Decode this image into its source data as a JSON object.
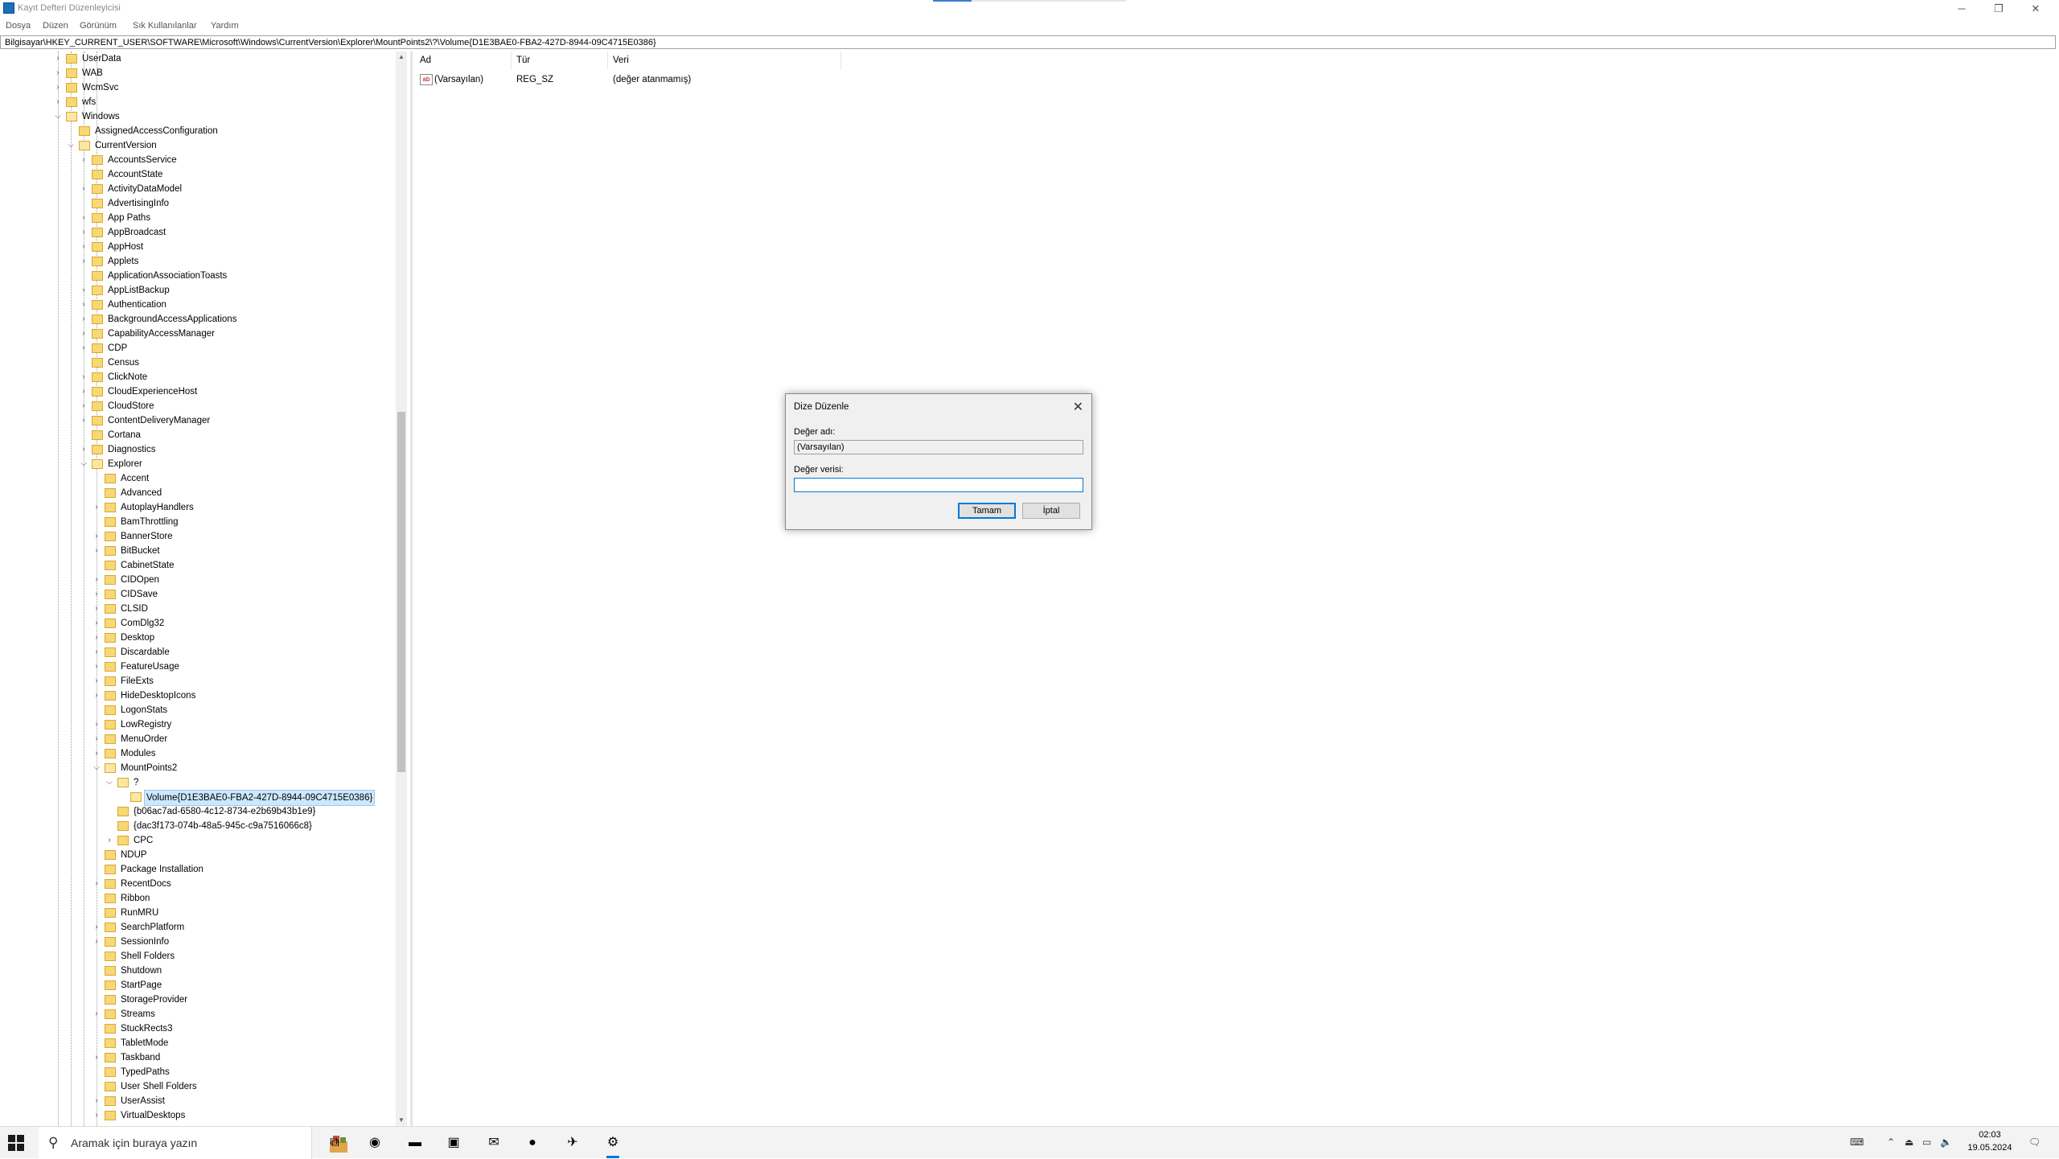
{
  "window": {
    "title": "Kayıt Defteri Düzenleyicisi",
    "controls": {
      "minimize": "─",
      "restore": "❐",
      "close": "✕"
    }
  },
  "menu": [
    "Dosya",
    "Düzen",
    "Görünüm",
    "Sık Kullanılanlar",
    "Yardım"
  ],
  "address": "Bilgisayar\\HKEY_CURRENT_USER\\SOFTWARE\\Microsoft\\Windows\\CurrentVersion\\Explorer\\MountPoints2\\?\\Volume{D1E3BAE0-FBA2-427D-8944-09C4715E0386}",
  "tree": [
    {
      "label": "UserData",
      "depth": 0,
      "exp": "right"
    },
    {
      "label": "WAB",
      "depth": 0,
      "exp": "right"
    },
    {
      "label": "WcmSvc",
      "depth": 0,
      "exp": "right"
    },
    {
      "label": "wfs",
      "depth": 0,
      "exp": "right"
    },
    {
      "label": "Windows",
      "depth": 0,
      "exp": "down"
    },
    {
      "label": "AssignedAccessConfiguration",
      "depth": 1,
      "exp": ""
    },
    {
      "label": "CurrentVersion",
      "depth": 1,
      "exp": "down"
    },
    {
      "label": "AccountsService",
      "depth": 2,
      "exp": "right"
    },
    {
      "label": "AccountState",
      "depth": 2,
      "exp": ""
    },
    {
      "label": "ActivityDataModel",
      "depth": 2,
      "exp": "right"
    },
    {
      "label": "AdvertisingInfo",
      "depth": 2,
      "exp": ""
    },
    {
      "label": "App Paths",
      "depth": 2,
      "exp": "right"
    },
    {
      "label": "AppBroadcast",
      "depth": 2,
      "exp": "right"
    },
    {
      "label": "AppHost",
      "depth": 2,
      "exp": "right"
    },
    {
      "label": "Applets",
      "depth": 2,
      "exp": "right"
    },
    {
      "label": "ApplicationAssociationToasts",
      "depth": 2,
      "exp": ""
    },
    {
      "label": "AppListBackup",
      "depth": 2,
      "exp": "right"
    },
    {
      "label": "Authentication",
      "depth": 2,
      "exp": "right"
    },
    {
      "label": "BackgroundAccessApplications",
      "depth": 2,
      "exp": "right"
    },
    {
      "label": "CapabilityAccessManager",
      "depth": 2,
      "exp": "right"
    },
    {
      "label": "CDP",
      "depth": 2,
      "exp": "right"
    },
    {
      "label": "Census",
      "depth": 2,
      "exp": ""
    },
    {
      "label": "ClickNote",
      "depth": 2,
      "exp": "right"
    },
    {
      "label": "CloudExperienceHost",
      "depth": 2,
      "exp": "right"
    },
    {
      "label": "CloudStore",
      "depth": 2,
      "exp": "right"
    },
    {
      "label": "ContentDeliveryManager",
      "depth": 2,
      "exp": "right"
    },
    {
      "label": "Cortana",
      "depth": 2,
      "exp": ""
    },
    {
      "label": "Diagnostics",
      "depth": 2,
      "exp": "right"
    },
    {
      "label": "Explorer",
      "depth": 2,
      "exp": "down"
    },
    {
      "label": "Accent",
      "depth": 3,
      "exp": ""
    },
    {
      "label": "Advanced",
      "depth": 3,
      "exp": ""
    },
    {
      "label": "AutoplayHandlers",
      "depth": 3,
      "exp": "right"
    },
    {
      "label": "BamThrottling",
      "depth": 3,
      "exp": ""
    },
    {
      "label": "BannerStore",
      "depth": 3,
      "exp": "right"
    },
    {
      "label": "BitBucket",
      "depth": 3,
      "exp": "right"
    },
    {
      "label": "CabinetState",
      "depth": 3,
      "exp": ""
    },
    {
      "label": "CIDOpen",
      "depth": 3,
      "exp": "right"
    },
    {
      "label": "CIDSave",
      "depth": 3,
      "exp": "right"
    },
    {
      "label": "CLSID",
      "depth": 3,
      "exp": "right"
    },
    {
      "label": "ComDlg32",
      "depth": 3,
      "exp": "right"
    },
    {
      "label": "Desktop",
      "depth": 3,
      "exp": "right"
    },
    {
      "label": "Discardable",
      "depth": 3,
      "exp": "right"
    },
    {
      "label": "FeatureUsage",
      "depth": 3,
      "exp": "right"
    },
    {
      "label": "FileExts",
      "depth": 3,
      "exp": "right"
    },
    {
      "label": "HideDesktopIcons",
      "depth": 3,
      "exp": "right"
    },
    {
      "label": "LogonStats",
      "depth": 3,
      "exp": ""
    },
    {
      "label": "LowRegistry",
      "depth": 3,
      "exp": "right"
    },
    {
      "label": "MenuOrder",
      "depth": 3,
      "exp": "right"
    },
    {
      "label": "Modules",
      "depth": 3,
      "exp": "right"
    },
    {
      "label": "MountPoints2",
      "depth": 3,
      "exp": "down"
    },
    {
      "label": "?",
      "depth": 4,
      "exp": "down"
    },
    {
      "label": "Volume{D1E3BAE0-FBA2-427D-8944-09C4715E0386}",
      "depth": 5,
      "exp": "",
      "selected": true
    },
    {
      "label": "{b06ac7ad-6580-4c12-8734-e2b69b43b1e9}",
      "depth": 4,
      "exp": ""
    },
    {
      "label": "{dac3f173-074b-48a5-945c-c9a7516066c8}",
      "depth": 4,
      "exp": ""
    },
    {
      "label": "CPC",
      "depth": 4,
      "exp": "right"
    },
    {
      "label": "NDUP",
      "depth": 3,
      "exp": ""
    },
    {
      "label": "Package Installation",
      "depth": 3,
      "exp": ""
    },
    {
      "label": "RecentDocs",
      "depth": 3,
      "exp": "right"
    },
    {
      "label": "Ribbon",
      "depth": 3,
      "exp": ""
    },
    {
      "label": "RunMRU",
      "depth": 3,
      "exp": ""
    },
    {
      "label": "SearchPlatform",
      "depth": 3,
      "exp": "right"
    },
    {
      "label": "SessionInfo",
      "depth": 3,
      "exp": "right"
    },
    {
      "label": "Shell Folders",
      "depth": 3,
      "exp": ""
    },
    {
      "label": "Shutdown",
      "depth": 3,
      "exp": ""
    },
    {
      "label": "StartPage",
      "depth": 3,
      "exp": ""
    },
    {
      "label": "StorageProvider",
      "depth": 3,
      "exp": ""
    },
    {
      "label": "Streams",
      "depth": 3,
      "exp": "right"
    },
    {
      "label": "StuckRects3",
      "depth": 3,
      "exp": ""
    },
    {
      "label": "TabletMode",
      "depth": 3,
      "exp": ""
    },
    {
      "label": "Taskband",
      "depth": 3,
      "exp": "right"
    },
    {
      "label": "TypedPaths",
      "depth": 3,
      "exp": ""
    },
    {
      "label": "User Shell Folders",
      "depth": 3,
      "exp": ""
    },
    {
      "label": "UserAssist",
      "depth": 3,
      "exp": "right"
    },
    {
      "label": "VirtualDesktops",
      "depth": 3,
      "exp": "right"
    }
  ],
  "list": {
    "columns": [
      "Ad",
      "Tür",
      "Veri"
    ],
    "rows": [
      {
        "icon": "ab",
        "name": "(Varsayılan)",
        "type": "REG_SZ",
        "data": "(değer atanmamış)"
      }
    ]
  },
  "dialog": {
    "title": "Dize Düzenle",
    "close": "✕",
    "value_name_label": "Değer adı:",
    "value_name": "(Varsayılan)",
    "value_data_label": "Değer verisi:",
    "value_data": "",
    "ok": "Tamam",
    "cancel": "İptal"
  },
  "taskbar": {
    "search_placeholder": "Aramak için buraya yazın",
    "apps": [
      {
        "name": "task-view-icon",
        "glyph": "⧉",
        "running": false
      },
      {
        "name": "edge-icon",
        "glyph": "◉",
        "running": false
      },
      {
        "name": "file-explorer-icon",
        "glyph": "▬",
        "running": false
      },
      {
        "name": "store-icon",
        "glyph": "▣",
        "running": false
      },
      {
        "name": "mail-icon",
        "glyph": "✉",
        "running": false
      },
      {
        "name": "chrome-icon",
        "glyph": "●",
        "running": false
      },
      {
        "name": "app-icon",
        "glyph": "✈",
        "running": false
      },
      {
        "name": "regedit-icon",
        "glyph": "⚙",
        "running": true
      }
    ],
    "time": "02:03",
    "date": "19.05.2024"
  },
  "colors": {
    "folder": "#f8d775",
    "selection": "#cce8ff",
    "accent": "#0078d7"
  }
}
